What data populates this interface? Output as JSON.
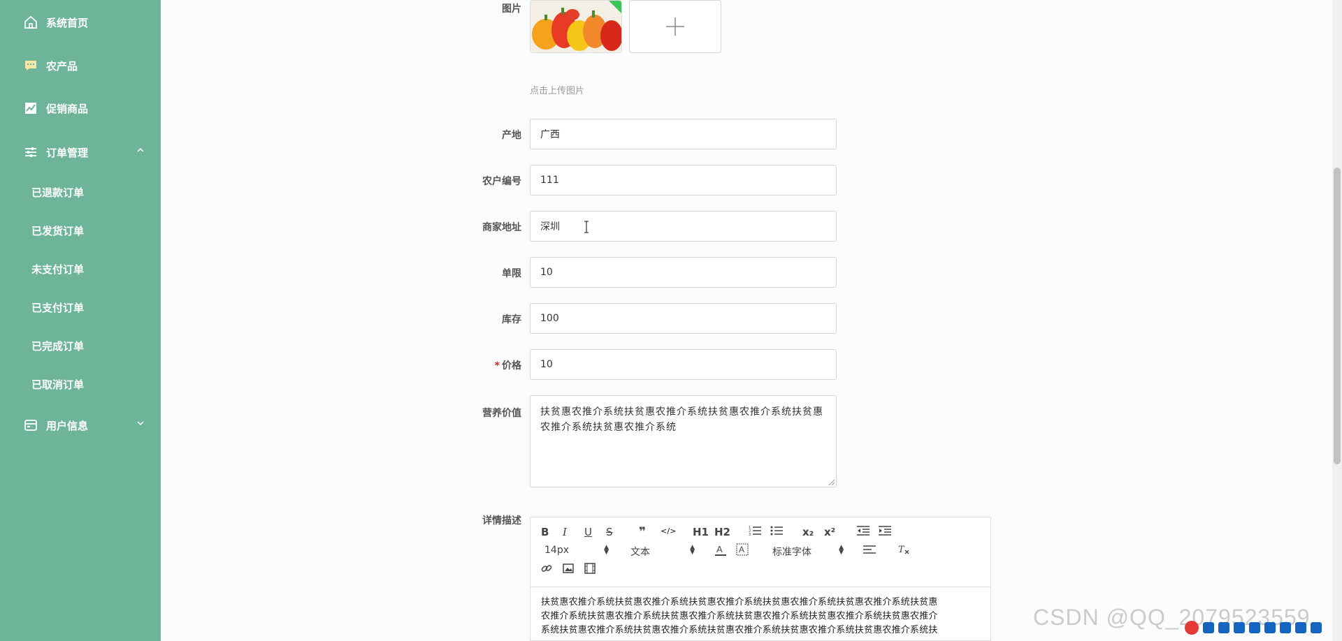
{
  "sidebar": {
    "items": [
      {
        "label": "系统首页",
        "icon": "home-icon"
      },
      {
        "label": "农产品",
        "icon": "chat-icon"
      },
      {
        "label": "促销商品",
        "icon": "chart-icon"
      },
      {
        "label": "订单管理",
        "icon": "sliders-icon",
        "expanded": true
      },
      {
        "label": "用户信息",
        "icon": "wallet-icon",
        "expanded": false
      }
    ],
    "order_sub_items": [
      {
        "label": "已退款订单"
      },
      {
        "label": "已发货订单"
      },
      {
        "label": "未支付订单"
      },
      {
        "label": "已支付订单"
      },
      {
        "label": "已完成订单"
      },
      {
        "label": "已取消订单"
      }
    ],
    "colors": {
      "background": "#6db498",
      "text": "#ffffff"
    }
  },
  "form": {
    "image": {
      "label": "图片",
      "hint": "点击上传图片"
    },
    "origin": {
      "label": "产地",
      "value": "广西"
    },
    "farmer_id": {
      "label": "农户编号",
      "value": "111"
    },
    "merchant_address": {
      "label": "商家地址",
      "value": "深圳"
    },
    "limit": {
      "label": "单限",
      "value": "10"
    },
    "stock": {
      "label": "库存",
      "value": "100"
    },
    "price": {
      "label": "价格",
      "value": "10",
      "required_mark": "*"
    },
    "nutrition": {
      "label": "营养价值",
      "value": "扶贫惠农推介系统扶贫惠农推介系统扶贫惠农推介系统扶贫惠农推介系统扶贫惠农推介系统"
    },
    "description": {
      "label": "详情描述"
    }
  },
  "editor": {
    "toolbar": {
      "bold": "B",
      "italic": "I",
      "underline": "U",
      "strike": "S",
      "quote": "❞",
      "code": "</>",
      "h1": "H1",
      "h2": "H2",
      "subscript": "x₂",
      "superscript": "x²",
      "font_size": "14px",
      "paragraph": "文本",
      "font_family": "标准字体"
    },
    "content": [
      "扶贫惠农推介系统扶贫惠农推介系统扶贫惠农推介系统扶贫惠农推介系统扶贫惠农推介系统扶贫惠",
      "农推介系统扶贫惠农推介系统扶贫惠农推介系统扶贫惠农推介系统扶贫惠农推介系统扶贫惠农推介",
      "系统扶贫惠农推介系统扶贫惠农推介系统扶贫惠农推介系统扶贫惠农推介系统扶贫惠农推介系统扶"
    ]
  },
  "watermark": "CSDN @QQ_2079523559",
  "accent_color": "#6db498"
}
